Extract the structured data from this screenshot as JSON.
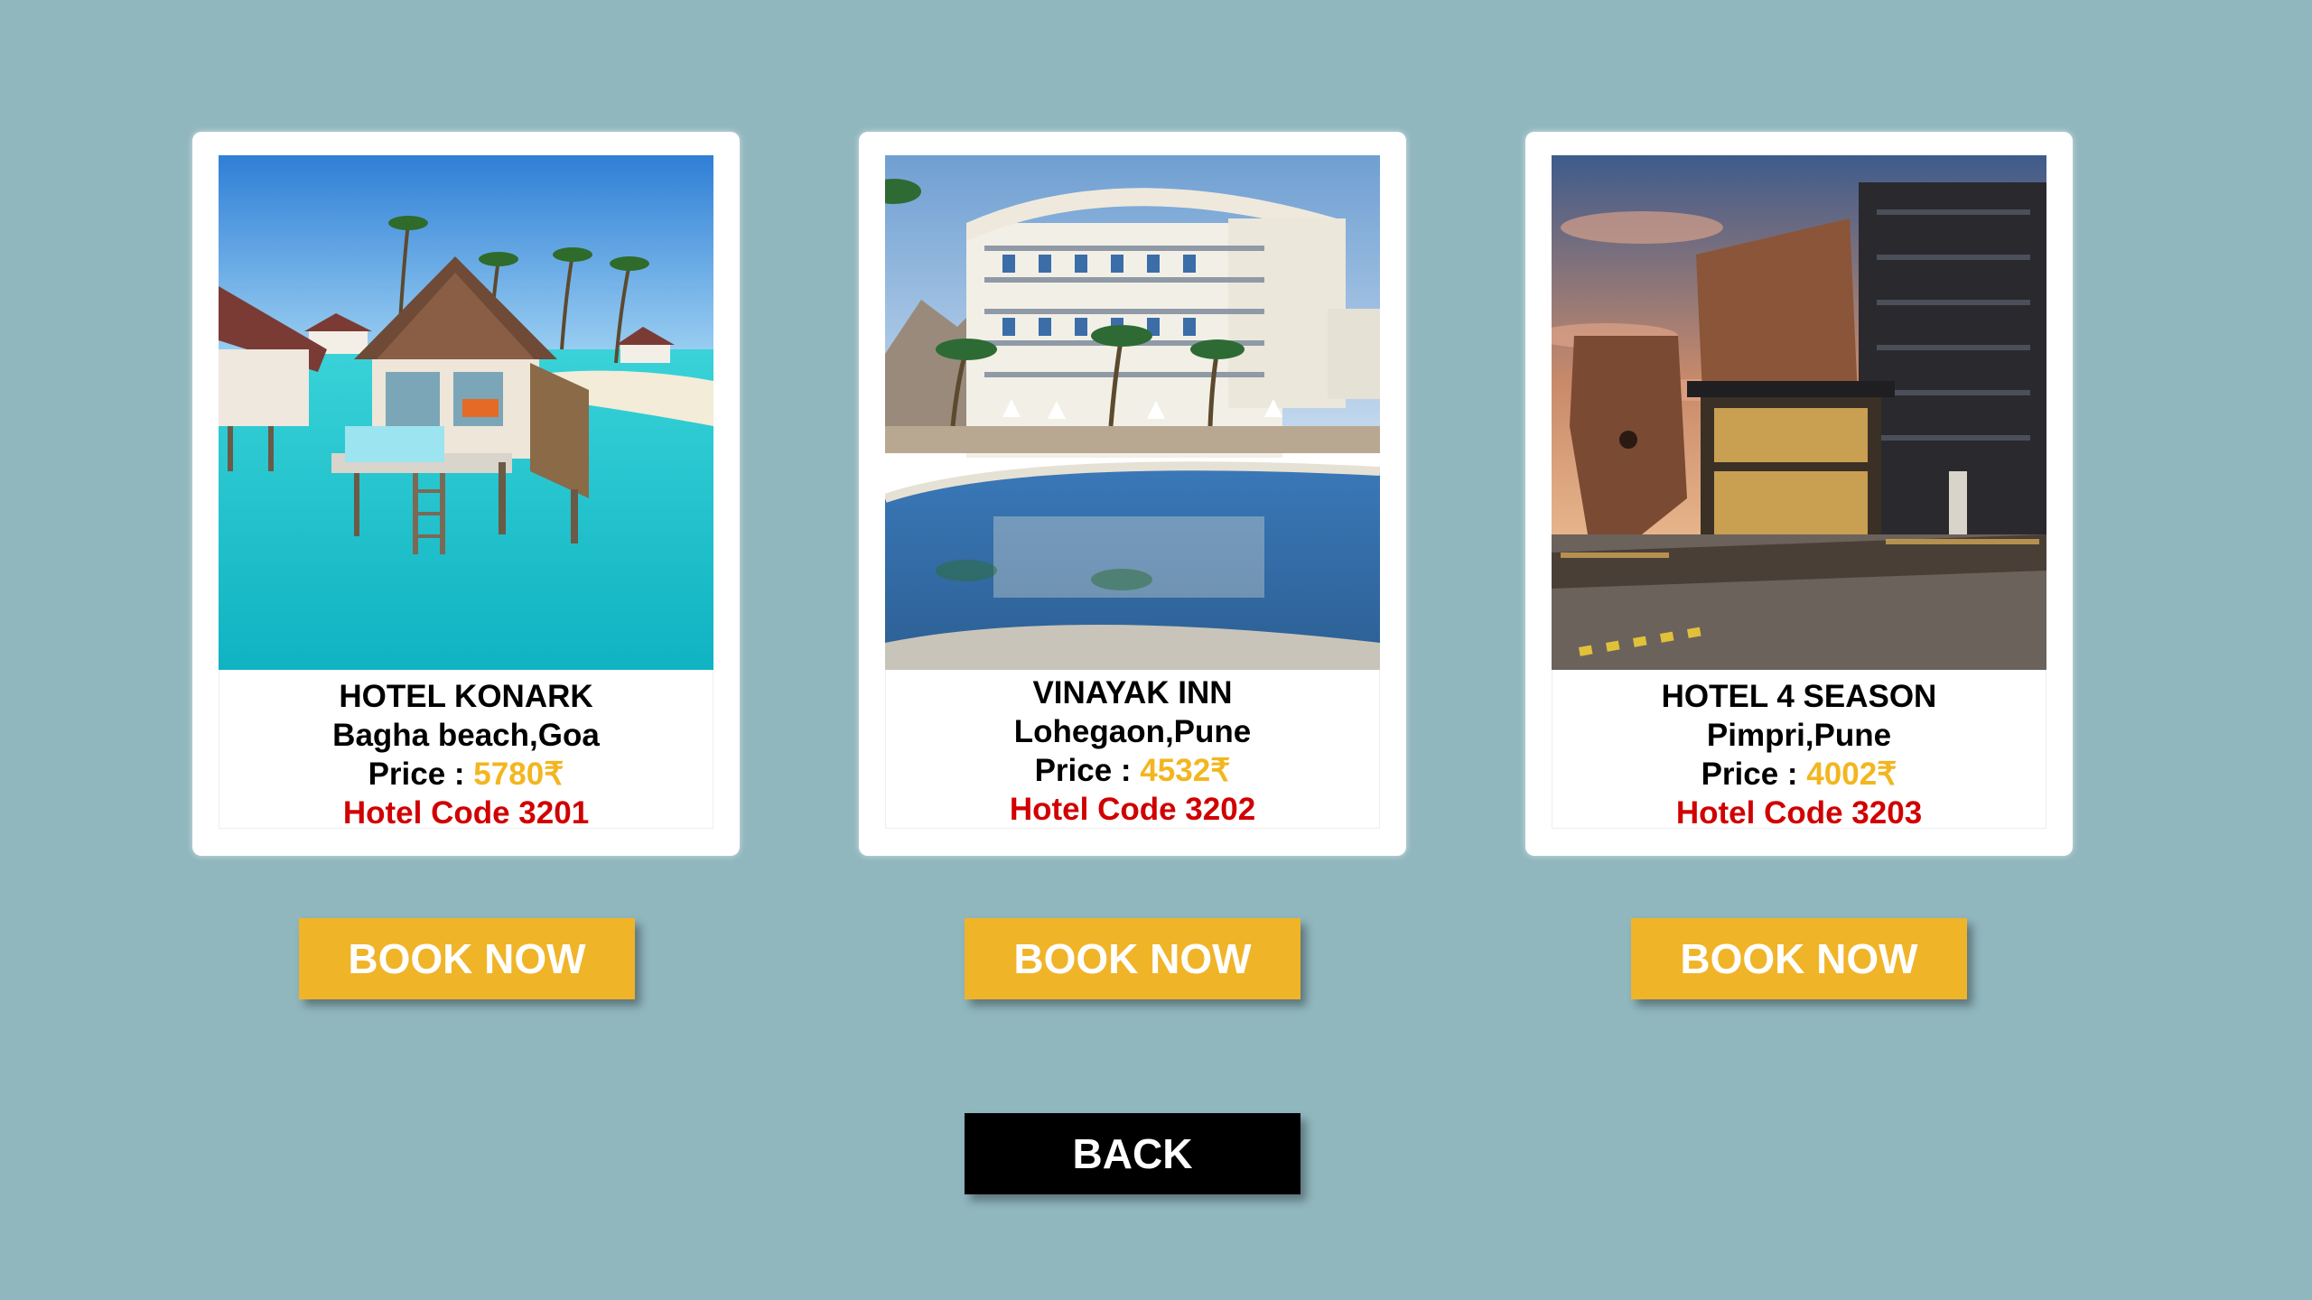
{
  "hotels": [
    {
      "name": "HOTEL KONARK",
      "location": "Bagha beach,Goa",
      "price_label": "Price : ",
      "price": "5780₹",
      "code": "Hotel Code 3201",
      "book_label": "BOOK NOW"
    },
    {
      "name": "VINAYAK INN",
      "location": "Lohegaon,Pune",
      "price_label": "Price : ",
      "price": "4532₹",
      "code": "Hotel Code 3202",
      "book_label": "BOOK NOW"
    },
    {
      "name": "HOTEL 4 SEASON",
      "location": "Pimpri,Pune",
      "price_label": "Price : ",
      "price": "4002₹",
      "code": "Hotel Code 3203",
      "book_label": "BOOK NOW"
    }
  ],
  "back_label": "BACK",
  "colors": {
    "background": "#90b6be",
    "button_accent": "#f0b429",
    "price_color": "#f2b61f",
    "code_color": "#d10000",
    "back_button": "#000000"
  }
}
